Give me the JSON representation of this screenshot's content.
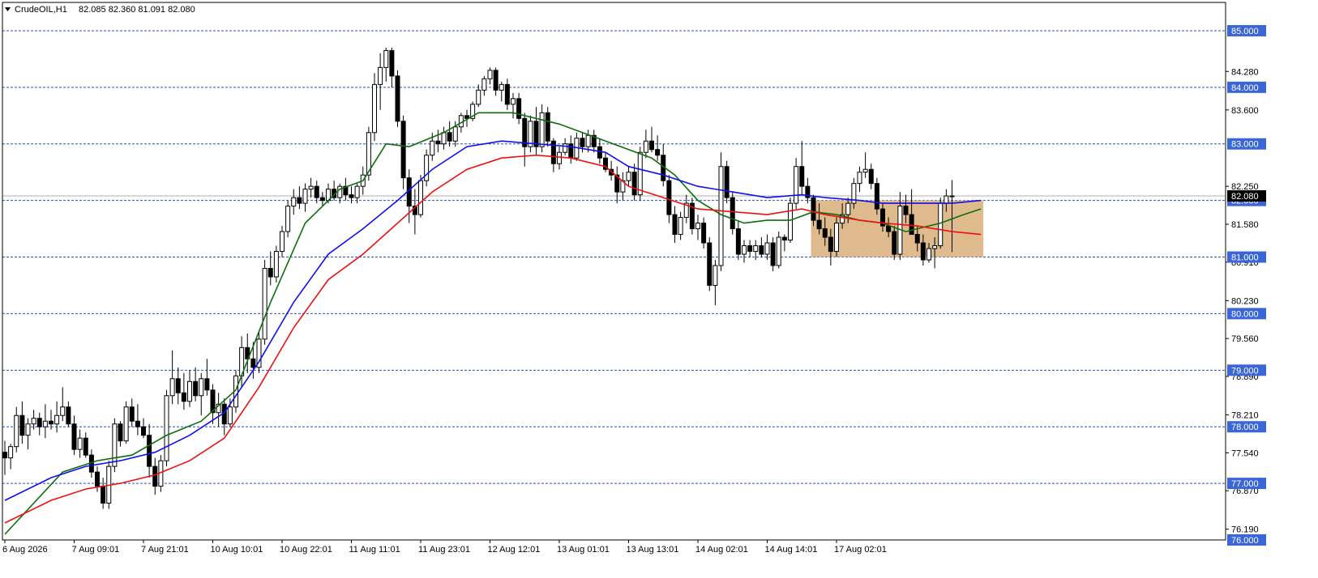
{
  "header": {
    "symbol_timeframe": "CrudeOIL,H1",
    "ohlc": "82.085 82.360 81.091 82.080",
    "menu_icon": "triangle-down-icon"
  },
  "colors": {
    "background": "#ffffff",
    "frame": "#000000",
    "level_line": "#2a50c8",
    "level_tag": "#3b66d6",
    "ma_fast": "#0d6e0d",
    "ma_mid": "#1010ee",
    "ma_slow": "#ee1010",
    "zone_fill": "#d9ae78",
    "bull_body": "#ffffff",
    "bear_body": "#000000"
  },
  "chart_data": {
    "type": "candlestick",
    "ylim": [
      76.0,
      85.5
    ],
    "grid": false,
    "y_ticks": [
      "85.000",
      "84.280",
      "84.000",
      "83.600",
      "83.000",
      "82.250",
      "82.000",
      "81.580",
      "81.000",
      "80.910",
      "80.230",
      "80.000",
      "79.560",
      "79.000",
      "78.890",
      "78.210",
      "78.000",
      "77.540",
      "77.000",
      "76.870",
      "76.190",
      "76.000"
    ],
    "levels": [
      85.0,
      84.0,
      83.0,
      82.0,
      81.0,
      80.0,
      79.0,
      78.0,
      77.0,
      76.0
    ],
    "level_labels": [
      "85.000",
      "84.000",
      "83.000",
      "82.000",
      "81.000",
      "80.000",
      "79.000",
      "78.000",
      "77.000",
      "76.000"
    ],
    "current_price": 82.08,
    "current_price_label": "82.080",
    "x_labels": [
      "6 Aug 2026",
      "7 Aug 09:01",
      "7 Aug 21:01",
      "10 Aug 10:01",
      "10 Aug 22:01",
      "11 Aug 11:01",
      "11 Aug 23:01",
      "12 Aug 12:01",
      "13 Aug 01:01",
      "13 Aug 13:01",
      "14 Aug 02:01",
      "14 Aug 14:01",
      "17 Aug 02:01"
    ],
    "x_label_candle_index": [
      0,
      12,
      24,
      36,
      48,
      60,
      72,
      84,
      96,
      108,
      120,
      132,
      144
    ],
    "zone": {
      "from_candle": 140,
      "to_candle": 169,
      "y_top": 82.0,
      "y_bottom": 81.0
    },
    "candles": [
      [
        77.55,
        77.75,
        77.15,
        77.45
      ],
      [
        77.45,
        77.7,
        77.25,
        77.65
      ],
      [
        77.65,
        78.35,
        77.55,
        78.2
      ],
      [
        78.2,
        78.45,
        77.7,
        77.85
      ],
      [
        77.85,
        78.15,
        77.6,
        78.05
      ],
      [
        78.05,
        78.3,
        77.95,
        78.15
      ],
      [
        78.15,
        78.25,
        77.85,
        78.0
      ],
      [
        78.0,
        78.4,
        77.8,
        78.1
      ],
      [
        78.1,
        78.3,
        77.95,
        78.05
      ],
      [
        78.05,
        78.45,
        77.9,
        78.2
      ],
      [
        78.2,
        78.7,
        78.1,
        78.35
      ],
      [
        78.35,
        78.45,
        78.0,
        78.05
      ],
      [
        78.05,
        78.2,
        77.5,
        77.6
      ],
      [
        77.6,
        77.95,
        77.45,
        77.8
      ],
      [
        77.8,
        77.9,
        77.45,
        77.5
      ],
      [
        77.5,
        77.6,
        77.1,
        77.2
      ],
      [
        77.2,
        77.3,
        76.85,
        76.95
      ],
      [
        76.95,
        77.1,
        76.55,
        76.65
      ],
      [
        76.65,
        77.4,
        76.55,
        77.3
      ],
      [
        77.3,
        78.15,
        77.2,
        78.05
      ],
      [
        78.05,
        78.1,
        77.65,
        77.75
      ],
      [
        77.75,
        78.45,
        77.7,
        78.35
      ],
      [
        78.35,
        78.5,
        78.0,
        78.1
      ],
      [
        78.1,
        78.4,
        77.85,
        78.0
      ],
      [
        78.0,
        78.15,
        77.8,
        77.85
      ],
      [
        77.85,
        78.05,
        77.1,
        77.3
      ],
      [
        77.3,
        77.45,
        76.8,
        76.95
      ],
      [
        76.95,
        77.5,
        76.85,
        77.4
      ],
      [
        77.4,
        78.65,
        77.3,
        78.55
      ],
      [
        78.55,
        79.35,
        78.4,
        78.85
      ],
      [
        78.85,
        79.05,
        78.4,
        78.6
      ],
      [
        78.6,
        78.95,
        78.3,
        78.45
      ],
      [
        78.45,
        79.0,
        78.35,
        78.8
      ],
      [
        78.8,
        79.05,
        78.45,
        78.55
      ],
      [
        78.55,
        78.95,
        78.2,
        78.85
      ],
      [
        78.85,
        79.2,
        78.55,
        78.65
      ],
      [
        78.65,
        78.75,
        78.05,
        78.25
      ],
      [
        78.25,
        78.6,
        78.0,
        78.4
      ],
      [
        78.4,
        78.5,
        77.85,
        78.05
      ],
      [
        78.05,
        78.5,
        78.0,
        78.35
      ],
      [
        78.35,
        79.0,
        78.25,
        78.9
      ],
      [
        78.9,
        79.6,
        78.7,
        79.4
      ],
      [
        79.4,
        79.65,
        78.95,
        79.2
      ],
      [
        79.2,
        79.5,
        78.85,
        79.05
      ],
      [
        79.05,
        79.7,
        78.95,
        79.55
      ],
      [
        79.55,
        80.95,
        79.45,
        80.8
      ],
      [
        80.8,
        81.1,
        80.5,
        80.65
      ],
      [
        80.65,
        81.2,
        80.55,
        81.1
      ],
      [
        81.1,
        81.55,
        81.0,
        81.45
      ],
      [
        81.45,
        82.0,
        81.35,
        81.9
      ],
      [
        81.9,
        82.2,
        81.75,
        82.05
      ],
      [
        82.05,
        82.25,
        81.85,
        81.95
      ],
      [
        81.95,
        82.3,
        81.8,
        82.2
      ],
      [
        82.2,
        82.4,
        82.05,
        82.25
      ],
      [
        82.25,
        82.35,
        81.95,
        82.05
      ],
      [
        82.05,
        82.15,
        81.9,
        82.0
      ],
      [
        82.0,
        82.3,
        81.95,
        82.2
      ],
      [
        82.2,
        82.35,
        82.0,
        82.05
      ],
      [
        82.05,
        82.3,
        81.95,
        82.25
      ],
      [
        82.25,
        82.4,
        82.0,
        82.1
      ],
      [
        82.1,
        82.25,
        81.95,
        82.05
      ],
      [
        82.05,
        82.3,
        81.95,
        82.25
      ],
      [
        82.25,
        82.6,
        82.1,
        82.45
      ],
      [
        82.45,
        83.3,
        82.35,
        83.2
      ],
      [
        83.2,
        84.25,
        83.05,
        84.05
      ],
      [
        84.05,
        84.6,
        83.6,
        84.35
      ],
      [
        84.35,
        84.7,
        84.1,
        84.65
      ],
      [
        84.65,
        84.7,
        84.0,
        84.2
      ],
      [
        84.2,
        84.3,
        83.3,
        83.4
      ],
      [
        83.4,
        83.5,
        82.2,
        82.4
      ],
      [
        82.4,
        82.55,
        81.6,
        81.9
      ],
      [
        81.9,
        82.2,
        81.4,
        81.75
      ],
      [
        81.75,
        82.45,
        81.7,
        82.35
      ],
      [
        82.35,
        82.9,
        82.25,
        82.8
      ],
      [
        82.8,
        83.2,
        82.7,
        83.05
      ],
      [
        83.05,
        83.25,
        82.85,
        83.0
      ],
      [
        83.0,
        83.3,
        82.9,
        83.2
      ],
      [
        83.2,
        83.4,
        82.95,
        83.05
      ],
      [
        83.05,
        83.4,
        82.95,
        83.3
      ],
      [
        83.3,
        83.55,
        83.2,
        83.5
      ],
      [
        83.5,
        83.6,
        83.3,
        83.45
      ],
      [
        83.45,
        83.75,
        83.4,
        83.7
      ],
      [
        83.7,
        84.05,
        83.65,
        83.95
      ],
      [
        83.95,
        84.2,
        83.85,
        84.15
      ],
      [
        84.15,
        84.35,
        84.05,
        84.3
      ],
      [
        84.3,
        84.35,
        83.85,
        83.95
      ],
      [
        83.95,
        84.1,
        83.75,
        84.05
      ],
      [
        84.05,
        84.15,
        83.6,
        83.7
      ],
      [
        83.7,
        83.9,
        83.45,
        83.8
      ],
      [
        83.8,
        83.9,
        83.35,
        83.45
      ],
      [
        83.45,
        83.55,
        82.6,
        82.95
      ],
      [
        82.95,
        83.5,
        82.85,
        83.4
      ],
      [
        83.4,
        83.65,
        82.8,
        82.95
      ],
      [
        82.95,
        83.7,
        82.85,
        83.55
      ],
      [
        83.55,
        83.65,
        82.95,
        83.05
      ],
      [
        83.05,
        83.1,
        82.5,
        82.65
      ],
      [
        82.65,
        82.95,
        82.55,
        82.85
      ],
      [
        82.85,
        83.1,
        82.8,
        83.0
      ],
      [
        83.0,
        83.15,
        82.65,
        82.75
      ],
      [
        82.75,
        83.2,
        82.7,
        83.1
      ],
      [
        83.1,
        83.2,
        82.85,
        82.95
      ],
      [
        82.95,
        83.25,
        82.85,
        83.15
      ],
      [
        83.15,
        83.25,
        82.85,
        82.95
      ],
      [
        82.95,
        83.1,
        82.65,
        82.75
      ],
      [
        82.75,
        82.85,
        82.5,
        82.55
      ],
      [
        82.55,
        82.7,
        82.35,
        82.45
      ],
      [
        82.45,
        82.6,
        81.95,
        82.15
      ],
      [
        82.15,
        82.5,
        82.0,
        82.35
      ],
      [
        82.35,
        82.6,
        82.25,
        82.5
      ],
      [
        82.5,
        82.65,
        82.0,
        82.1
      ],
      [
        82.1,
        82.95,
        82.0,
        82.85
      ],
      [
        82.85,
        83.25,
        82.75,
        83.05
      ],
      [
        83.05,
        83.3,
        82.85,
        82.9
      ],
      [
        82.9,
        83.15,
        82.7,
        82.8
      ],
      [
        82.8,
        83.0,
        82.25,
        82.35
      ],
      [
        82.35,
        82.45,
        81.6,
        81.75
      ],
      [
        81.75,
        81.9,
        81.25,
        81.4
      ],
      [
        81.4,
        81.8,
        81.3,
        81.7
      ],
      [
        81.7,
        82.1,
        81.6,
        81.95
      ],
      [
        81.95,
        82.05,
        81.4,
        81.5
      ],
      [
        81.5,
        81.75,
        81.3,
        81.6
      ],
      [
        81.6,
        81.7,
        81.15,
        81.25
      ],
      [
        81.25,
        81.35,
        80.4,
        80.5
      ],
      [
        80.5,
        80.95,
        80.15,
        80.85
      ],
      [
        80.85,
        82.85,
        80.75,
        82.6
      ],
      [
        82.6,
        82.7,
        81.95,
        82.05
      ],
      [
        82.05,
        82.15,
        81.4,
        81.5
      ],
      [
        81.5,
        81.65,
        80.95,
        81.05
      ],
      [
        81.05,
        81.3,
        80.9,
        81.2
      ],
      [
        81.2,
        81.3,
        81.0,
        81.1
      ],
      [
        81.1,
        81.3,
        80.95,
        81.2
      ],
      [
        81.2,
        81.35,
        81.0,
        81.05
      ],
      [
        81.05,
        81.4,
        80.95,
        81.25
      ],
      [
        81.25,
        81.35,
        80.75,
        80.85
      ],
      [
        80.85,
        81.45,
        80.8,
        81.35
      ],
      [
        81.35,
        81.4,
        81.1,
        81.3
      ],
      [
        81.3,
        82.05,
        81.25,
        81.95
      ],
      [
        81.95,
        82.75,
        81.85,
        82.6
      ],
      [
        82.6,
        83.05,
        82.1,
        82.25
      ],
      [
        82.25,
        82.4,
        81.95,
        82.05
      ],
      [
        82.05,
        82.1,
        81.55,
        81.65
      ],
      [
        81.65,
        81.95,
        81.4,
        81.5
      ],
      [
        81.5,
        81.7,
        81.2,
        81.35
      ],
      [
        81.35,
        81.5,
        80.85,
        81.1
      ],
      [
        81.1,
        81.7,
        81.0,
        81.6
      ],
      [
        81.6,
        81.95,
        81.5,
        81.75
      ],
      [
        81.75,
        82.05,
        81.6,
        81.95
      ],
      [
        81.95,
        82.4,
        81.85,
        82.3
      ],
      [
        82.3,
        82.6,
        82.15,
        82.5
      ],
      [
        82.5,
        82.85,
        82.4,
        82.55
      ],
      [
        82.55,
        82.65,
        82.2,
        82.3
      ],
      [
        82.3,
        82.4,
        81.75,
        81.85
      ],
      [
        81.85,
        81.95,
        81.45,
        81.55
      ],
      [
        81.55,
        81.7,
        81.35,
        81.45
      ],
      [
        81.45,
        81.55,
        80.95,
        81.05
      ],
      [
        81.05,
        82.15,
        80.95,
        81.9
      ],
      [
        81.9,
        82.1,
        81.6,
        81.75
      ],
      [
        81.75,
        82.2,
        81.65,
        81.4
      ],
      [
        81.4,
        81.55,
        81.1,
        81.25
      ],
      [
        81.25,
        81.4,
        80.85,
        80.95
      ],
      [
        80.95,
        81.25,
        80.9,
        81.15
      ],
      [
        81.15,
        81.35,
        80.8,
        81.2
      ],
      [
        81.2,
        82.05,
        81.15,
        81.95
      ],
      [
        81.95,
        82.2,
        81.8,
        82.08
      ],
      [
        82.08,
        82.36,
        81.09,
        82.08
      ]
    ],
    "ma_fast": [
      [
        0,
        76.1
      ],
      [
        10,
        77.2
      ],
      [
        16,
        77.4
      ],
      [
        22,
        77.5
      ],
      [
        28,
        77.85
      ],
      [
        34,
        78.1
      ],
      [
        40,
        78.65
      ],
      [
        46,
        80.2
      ],
      [
        52,
        81.6
      ],
      [
        58,
        82.2
      ],
      [
        62,
        82.35
      ],
      [
        66,
        83.0
      ],
      [
        70,
        82.95
      ],
      [
        76,
        83.2
      ],
      [
        82,
        83.55
      ],
      [
        88,
        83.55
      ],
      [
        96,
        83.35
      ],
      [
        104,
        83.05
      ],
      [
        108,
        82.9
      ],
      [
        112,
        82.75
      ],
      [
        116,
        82.45
      ],
      [
        120,
        82.0
      ],
      [
        124,
        81.75
      ],
      [
        128,
        81.6
      ],
      [
        132,
        81.65
      ],
      [
        136,
        81.65
      ],
      [
        140,
        81.8
      ],
      [
        144,
        81.75
      ],
      [
        148,
        81.65
      ],
      [
        152,
        81.6
      ],
      [
        156,
        81.45
      ],
      [
        162,
        81.6
      ],
      [
        166,
        81.75
      ],
      [
        169,
        81.85
      ]
    ],
    "ma_mid": [
      [
        0,
        76.7
      ],
      [
        8,
        77.1
      ],
      [
        14,
        77.3
      ],
      [
        20,
        77.4
      ],
      [
        26,
        77.55
      ],
      [
        32,
        77.85
      ],
      [
        38,
        78.25
      ],
      [
        44,
        79.15
      ],
      [
        50,
        80.2
      ],
      [
        56,
        81.05
      ],
      [
        62,
        81.5
      ],
      [
        68,
        82.0
      ],
      [
        74,
        82.55
      ],
      [
        80,
        82.95
      ],
      [
        86,
        83.05
      ],
      [
        92,
        83.0
      ],
      [
        98,
        82.95
      ],
      [
        104,
        82.85
      ],
      [
        108,
        82.6
      ],
      [
        114,
        82.45
      ],
      [
        120,
        82.25
      ],
      [
        126,
        82.15
      ],
      [
        132,
        82.05
      ],
      [
        138,
        82.1
      ],
      [
        142,
        82.05
      ],
      [
        148,
        82.0
      ],
      [
        152,
        81.95
      ],
      [
        158,
        81.95
      ],
      [
        164,
        81.95
      ],
      [
        169,
        82.0
      ]
    ],
    "ma_slow": [
      [
        0,
        76.3
      ],
      [
        8,
        76.7
      ],
      [
        14,
        76.9
      ],
      [
        20,
        77.0
      ],
      [
        26,
        77.15
      ],
      [
        32,
        77.4
      ],
      [
        38,
        77.8
      ],
      [
        44,
        78.7
      ],
      [
        50,
        79.75
      ],
      [
        56,
        80.6
      ],
      [
        62,
        81.05
      ],
      [
        68,
        81.6
      ],
      [
        74,
        82.15
      ],
      [
        80,
        82.55
      ],
      [
        86,
        82.75
      ],
      [
        92,
        82.8
      ],
      [
        98,
        82.75
      ],
      [
        104,
        82.6
      ],
      [
        108,
        82.25
      ],
      [
        114,
        82.05
      ],
      [
        120,
        81.85
      ],
      [
        126,
        81.8
      ],
      [
        132,
        81.75
      ],
      [
        138,
        81.85
      ],
      [
        142,
        81.75
      ],
      [
        148,
        81.65
      ],
      [
        152,
        81.6
      ],
      [
        158,
        81.55
      ],
      [
        164,
        81.45
      ],
      [
        169,
        81.4
      ]
    ]
  }
}
